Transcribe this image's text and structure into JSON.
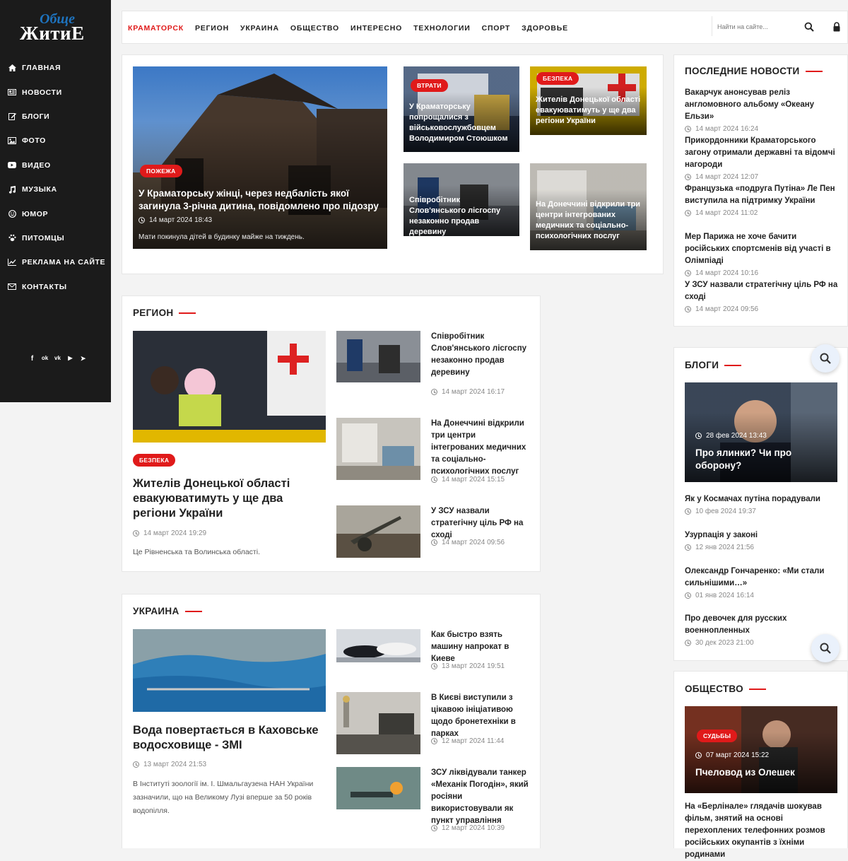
{
  "brand": {
    "logo_top": "Обще",
    "logo_bottom": "ЖитиЕ"
  },
  "sidebar": {
    "items": [
      {
        "label": "ГЛАВНАЯ",
        "icon": "home-icon"
      },
      {
        "label": "НОВОСТИ",
        "icon": "newspaper-icon"
      },
      {
        "label": "БЛОГИ",
        "icon": "edit-icon"
      },
      {
        "label": "ФОТО",
        "icon": "image-icon"
      },
      {
        "label": "ВИДЕО",
        "icon": "youtube-icon"
      },
      {
        "label": "МУЗЫКА",
        "icon": "music-icon"
      },
      {
        "label": "ЮМОР",
        "icon": "smile-icon"
      },
      {
        "label": "ПИТОМЦЫ",
        "icon": "paw-icon"
      },
      {
        "label": "РЕКЛАМА НА САЙТЕ",
        "icon": "chart-icon"
      },
      {
        "label": "КОНТАКТЫ",
        "icon": "envelope-icon"
      }
    ],
    "social": [
      {
        "glyph": "f",
        "icon": "facebook-icon"
      },
      {
        "glyph": "ok",
        "icon": "odnoklassniki-icon"
      },
      {
        "glyph": "vk",
        "icon": "vk-icon"
      },
      {
        "glyph": "▶",
        "icon": "youtube-social-icon"
      },
      {
        "glyph": "➤",
        "icon": "telegram-icon"
      }
    ]
  },
  "topnav": {
    "items": [
      "КРАМАТОРСК",
      "РЕГИОН",
      "УКРАИНА",
      "ОБЩЕСТВО",
      "ИНТЕРЕСНО",
      "ТЕХНОЛОГИИ",
      "СПОРТ",
      "ЗДОРОВЬЕ"
    ],
    "active_index": 0,
    "search_placeholder": "Найти на сайте..."
  },
  "featured": {
    "main": {
      "badge": "ПОЖЕЖА",
      "title": "У Краматорську жінці, через недбалість якої загинула 3-річна дитина, повідомлено про підозру",
      "date": "14 март 2024 18:43",
      "excerpt": "Мати покинула дітей в будинку майже на тиждень."
    },
    "tiles": [
      {
        "badge": "ВТРАТИ",
        "title": "У Краматорську попрощалися з військовослужбовцем Володимиром Стоюшком"
      },
      {
        "badge": "БЕЗПЕКА",
        "title": "Жителів Донецької області евакуюватимуть у ще два регіони України"
      },
      {
        "badge": "",
        "title": "Співробітник Слов'янського лісгоспу незаконно продав деревину"
      },
      {
        "badge": "",
        "title": "На Донеччині відкрили три центри інтегрованих медичних та соціально-психологічних послуг"
      }
    ]
  },
  "latest": {
    "title": "ПОСЛЕДНИЕ НОВОСТИ",
    "items": [
      {
        "title": "Вакарчук анонсував реліз англомовного альбому «Океану Ельзи»",
        "date": "14 март 2024 16:24"
      },
      {
        "title": "Прикордонники Краматорського загону отримали державні та відомчі нагороди",
        "date": "14 март 2024 12:07"
      },
      {
        "title": "Французька «подруга Путіна» Ле Пен виступила на підтримку України",
        "date": "14 март 2024 11:02"
      },
      {
        "title": "Мер Парижа не хоче бачити російських спортсменів від участі в Олімпіаді",
        "date": "14 март 2024 10:16"
      },
      {
        "title": "У ЗСУ назвали стратегічну ціль РФ на сході",
        "date": "14 март 2024 09:56"
      }
    ]
  },
  "region": {
    "title": "РЕГИОН",
    "main": {
      "badge": "БЕЗПЕКА",
      "title": "Жителів Донецької області евакуюватимуть у ще два регіони України",
      "date": "14 март 2024 19:29",
      "excerpt": "Це Рівненська та Волинська області."
    },
    "items": [
      {
        "title": "Співробітник Слов'янського лісгоспу незаконно продав деревину",
        "date": "14 март 2024 16:17"
      },
      {
        "title": "На Донеччині відкрили три центри інтегрованих медичних та соціально-психологічних послуг",
        "date": "14 март 2024 15:15"
      },
      {
        "title": "У ЗСУ назвали стратегічну ціль РФ на сході",
        "date": "14 март 2024 09:56"
      }
    ]
  },
  "ukraine": {
    "title": "УКРАИНА",
    "main": {
      "title": "Вода повертається в Каховське водосховище - ЗМІ",
      "date": "13 март 2024 21:53",
      "excerpt": "В Інституті зоології ім. І. Шмальгаузена НАН України зазначили, що на Великому Лузі вперше за 50 років водопілля."
    },
    "items": [
      {
        "title": "Как быстро взять машину напрокат в Киеве",
        "date": "13 март 2024 19:51"
      },
      {
        "title": "В Києві виступили з цікавою ініціативою щодо бронетехніки в парках",
        "date": "12 март 2024 11:44"
      },
      {
        "title": "ЗСУ ліквідували танкер «Механік Погодін», який росіяни використовували як пункт управління",
        "date": "12 март 2024 10:39"
      }
    ]
  },
  "blogs": {
    "title": "БЛОГИ",
    "main": {
      "date": "28 фев 2024 13:43",
      "title": "Про ялинки? Чи про оборону?"
    },
    "items": [
      {
        "title": "Як у Космачах путіна порадували",
        "date": "10 фев 2024 19:37"
      },
      {
        "title": "Узурпація у законі",
        "date": "12 янв 2024 21:56"
      },
      {
        "title": "Олександр Гончаренко: «Ми стали сильнішими…»",
        "date": "01 янв 2024 16:14"
      },
      {
        "title": "Про девочек для русских военнопленных",
        "date": "30 дек 2023 21:00"
      }
    ]
  },
  "society": {
    "title": "ОБЩЕСТВО",
    "main": {
      "badge": "СУДЬБЫ",
      "date": "07 март 2024 15:22",
      "title": "Пчеловод из Олешек"
    },
    "items": [
      {
        "title": "На «Берлінале» глядачів шокував фільм, знятий на основі перехоплених телефонних розмов російських окупантів з їхніми родинами"
      }
    ]
  },
  "colors": {
    "accent": "#e01a1a",
    "sidebar_bg": "#1b1b1b",
    "logo_blue": "#1e73be"
  }
}
